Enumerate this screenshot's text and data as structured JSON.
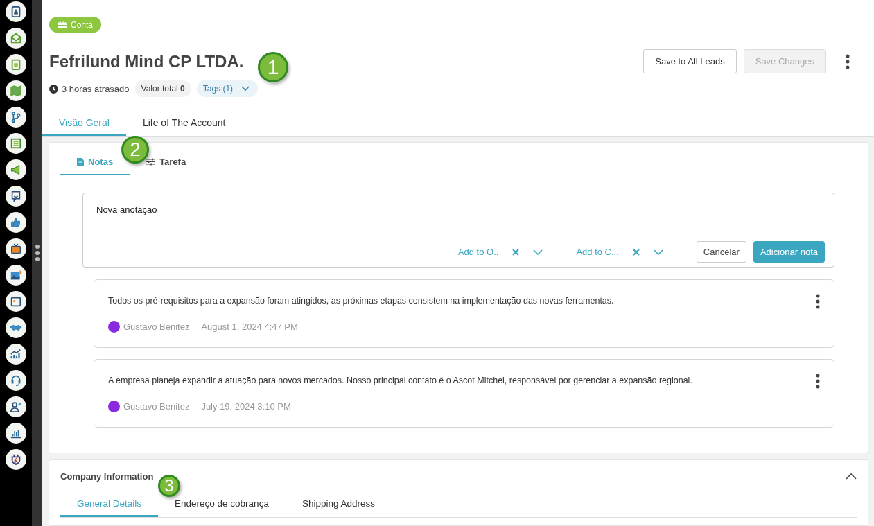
{
  "record_badge": {
    "label": "Conta"
  },
  "title": "Fefrilund Mind CP LTDA.",
  "meta": {
    "last_activity": "3 horas atrasado",
    "total_label": "Valor total",
    "total_value": "0",
    "tags": "Tags (1)"
  },
  "actions": [
    {
      "label": "Save to All Leads",
      "disabled": false
    },
    {
      "label": "Save Changes",
      "disabled": true
    }
  ],
  "tabs": [
    {
      "label": "Visão Geral",
      "selected": true
    },
    {
      "label": "Life of The Account",
      "selected": false
    }
  ],
  "activity_tabs": [
    {
      "label": "Notas",
      "kind": "document",
      "selected": true
    },
    {
      "label": "Tarefa",
      "kind": "sliders",
      "selected": false
    }
  ],
  "note_editor": {
    "value": "Nova anotação",
    "links": [
      {
        "label": "Add to O.."
      },
      {
        "label": "Add to C..."
      }
    ],
    "buttons": [
      {
        "label": "Cancelar",
        "kind": "secondary"
      },
      {
        "label": "Adicionar nota",
        "kind": "primary"
      }
    ]
  },
  "notes": [
    {
      "text": "Todos os pré-requisitos para a expansão foram atingidos, as próximas etapas consistem na implementação das novas ferramentas.",
      "author": "Gustavo Benitez",
      "date": "August 1, 2024 4:47 PM"
    },
    {
      "text": "A empresa planeja expandir a atuação para novos mercados. Nosso principal contato é o Ascot Mitchel, responsável por gerenciar a expansão regional.",
      "author": "Gustavo Benitez",
      "date": "July 19, 2024 3:10 PM"
    }
  ],
  "company_information": {
    "title": "Company Information",
    "expanded": true,
    "tabs": [
      {
        "label": "General Details",
        "selected": true
      },
      {
        "label": "Endereço de cobrança",
        "selected": false
      },
      {
        "label": "Shipping Address",
        "selected": false
      }
    ]
  },
  "callouts": [
    {
      "label": "1"
    },
    {
      "label": "2"
    },
    {
      "label": "3"
    }
  ]
}
